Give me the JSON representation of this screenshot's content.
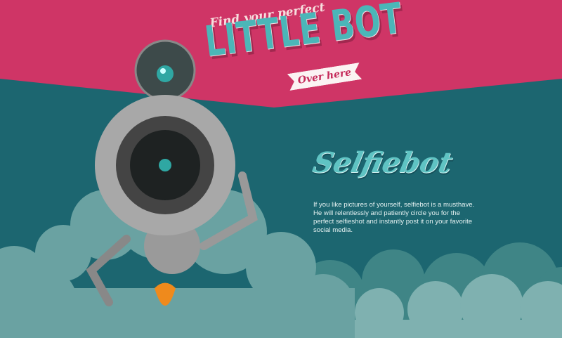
{
  "header": {
    "tagline": "Find your perfect",
    "title": "LITTLE BOT",
    "ribbon_label": "Over here"
  },
  "product": {
    "name": "Selfiebot",
    "description": "If you like pictures of yourself, selfiebot is a musthave. He will relentlessly and patiently circle you for the perfect selfieshot and instantly post it on your favorite social media."
  },
  "colors": {
    "header_pink": "#cf3566",
    "teal_bg": "#1c6670",
    "title_teal": "#4bb6b8",
    "cloud": "#6aa2a2"
  }
}
